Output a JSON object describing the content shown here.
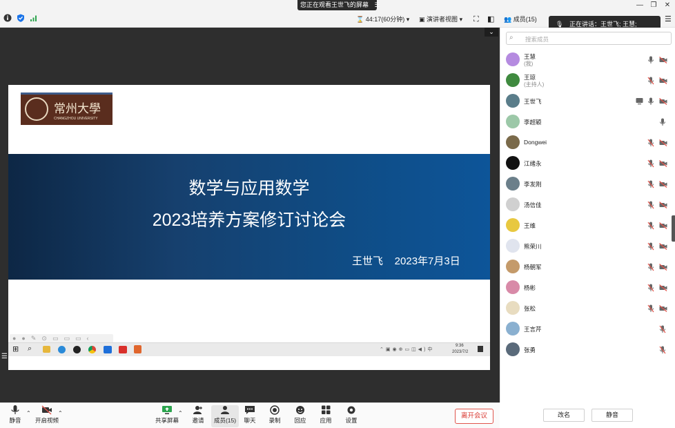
{
  "colors": {
    "brand_blue": "#1a73e8",
    "leave_red": "#d93a32",
    "slide_band": "#0f4c85"
  },
  "banner": {
    "text": "您正在观看王世飞的屏幕",
    "icon": "list-icon"
  },
  "toolbar": {
    "timer": "44:17(60分钟)",
    "view_mode": "演讲者视图",
    "members_tab": "成员(15)"
  },
  "speaking": {
    "text": "正在讲话：王世飞; 王慧;"
  },
  "slide": {
    "title_line1": "数学与应用数学",
    "title_line2": "2023培养方案修订讨论会",
    "presenter_date": "王世飞    2023年7月3日",
    "logo_text": "常州大學",
    "logo_subtext": "CHANGZHOU UNIVERSITY",
    "taskbar_time": "9:36",
    "taskbar_date": "2023/7/2"
  },
  "search": {
    "placeholder": "搜索成员"
  },
  "members": [
    {
      "name": "王慧",
      "sub": "(我)",
      "mic": "on",
      "video": "off",
      "screen": false,
      "avatar_color": "#b58be0"
    },
    {
      "name": "王琼",
      "sub": "(主持人)",
      "mic": "muted",
      "video": "off",
      "screen": false,
      "avatar_color": "#3f8a3f"
    },
    {
      "name": "王世飞",
      "sub": "",
      "mic": "on",
      "video": "off",
      "screen": true,
      "avatar_color": "#5a7d8a"
    },
    {
      "name": "李超颖",
      "sub": "",
      "mic": "on",
      "video": "none",
      "screen": false,
      "avatar_color": "#9cc8a8"
    },
    {
      "name": "Dongwei",
      "sub": "",
      "mic": "muted",
      "video": "off",
      "screen": false,
      "avatar_color": "#7a6a4a"
    },
    {
      "name": "江绪永",
      "sub": "",
      "mic": "muted",
      "video": "off",
      "screen": false,
      "avatar_color": "#111111"
    },
    {
      "name": "李发刚",
      "sub": "",
      "mic": "muted",
      "video": "off",
      "screen": false,
      "avatar_color": "#6b7f8a"
    },
    {
      "name": "汤信佳",
      "sub": "",
      "mic": "muted",
      "video": "off",
      "screen": false,
      "avatar_color": "#d0d0d0"
    },
    {
      "name": "王维",
      "sub": "",
      "mic": "muted",
      "video": "off",
      "screen": false,
      "avatar_color": "#e8c840"
    },
    {
      "name": "熊荣川",
      "sub": "",
      "mic": "muted",
      "video": "off",
      "screen": false,
      "avatar_color": "#e0e4ee"
    },
    {
      "name": "杨朝军",
      "sub": "",
      "mic": "muted",
      "video": "off",
      "screen": false,
      "avatar_color": "#c49a6a"
    },
    {
      "name": "杨彬",
      "sub": "",
      "mic": "muted",
      "video": "off",
      "screen": false,
      "avatar_color": "#d88aa8"
    },
    {
      "name": "张松",
      "sub": "",
      "mic": "muted",
      "video": "off",
      "screen": false,
      "avatar_color": "#e8dcc0"
    },
    {
      "name": "王言芹",
      "sub": "",
      "mic": "muted",
      "video": "none",
      "screen": false,
      "avatar_color": "#8ab0d0"
    },
    {
      "name": "张勇",
      "sub": "",
      "mic": "muted",
      "video": "none",
      "screen": false,
      "avatar_color": "#5a6a7a"
    }
  ],
  "panel_buttons": {
    "rename": "改名",
    "mute": "静音"
  },
  "bottombar": {
    "mute": "静音",
    "video": "开启视频",
    "share": "共享屏幕",
    "invite": "邀请",
    "members": "成员(15)",
    "chat": "聊天",
    "record": "录制",
    "rollcall": "回应",
    "apps": "应用",
    "settings": "设置",
    "leave": "离开会议"
  }
}
